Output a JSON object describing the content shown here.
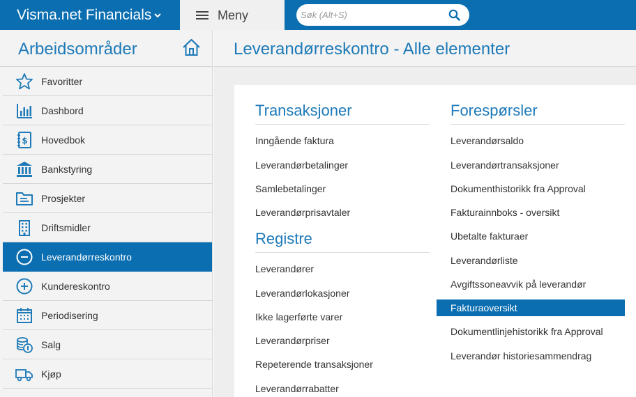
{
  "topbar": {
    "app_title": "Visma.net Financials",
    "menu_label": "Meny",
    "search_placeholder": "Søk (Alt+S)"
  },
  "sidebar": {
    "title": "Arbeidsområder",
    "items": [
      {
        "label": "Favoritter",
        "icon": "star-icon"
      },
      {
        "label": "Dashbord",
        "icon": "bar-chart-icon"
      },
      {
        "label": "Hovedbok",
        "icon": "ledger-dollar-icon"
      },
      {
        "label": "Bankstyring",
        "icon": "bank-icon"
      },
      {
        "label": "Prosjekter",
        "icon": "folder-icon"
      },
      {
        "label": "Driftsmidler",
        "icon": "building-icon"
      },
      {
        "label": "Leverandørreskontro",
        "icon": "minus-circle-icon",
        "active": true
      },
      {
        "label": "Kundereskontro",
        "icon": "plus-circle-icon"
      },
      {
        "label": "Periodisering",
        "icon": "calendar-icon"
      },
      {
        "label": "Salg",
        "icon": "coins-icon"
      },
      {
        "label": "Kjøp",
        "icon": "truck-icon"
      }
    ]
  },
  "main": {
    "title": "Leverandørreskontro - Alle elementer",
    "sections": {
      "transaksjoner": {
        "title": "Transaksjoner",
        "links": [
          "Inngående faktura",
          "Leverandørbetalinger",
          "Samlebetalinger",
          "Leverandørprisavtaler"
        ]
      },
      "registre": {
        "title": "Registre",
        "links": [
          "Leverandører",
          "Leverandørlokasjoner",
          "Ikke lagerførte varer",
          "Leverandørpriser",
          "Repeterende transaksjoner",
          "Leverandørrabatter"
        ]
      },
      "foresporsler": {
        "title": "Forespørsler",
        "links": [
          "Leverandørsaldo",
          "Leverandørtransaksjoner",
          "Dokumenthistorikk fra Approval",
          "Fakturainnboks - oversikt",
          "Ubetalte fakturaer",
          "Leverandørliste",
          "Avgiftssoneavvik på leverandør",
          "Fakturaoversikt",
          "Dokumentlinjehistorikk fra Approval",
          "Leverandør historiesammendrag"
        ],
        "selected_index": 7
      }
    }
  },
  "colors": {
    "brand_blue": "#0a6eb1",
    "heading_blue": "#1e7ab8",
    "sidebar_bg": "#f3f3f3"
  }
}
